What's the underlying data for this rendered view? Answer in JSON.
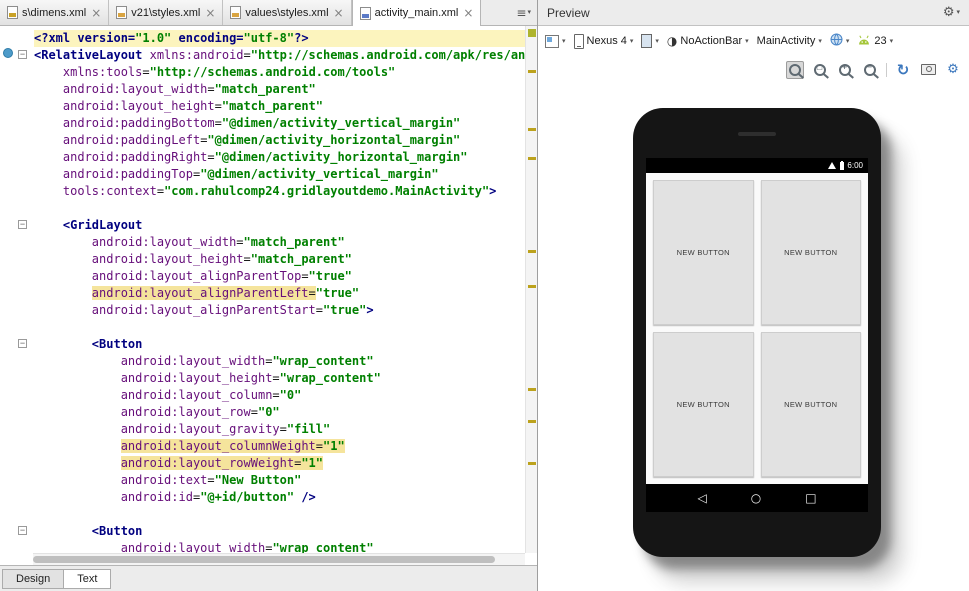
{
  "colors": {
    "tag": "#000080",
    "attribute": "#660E7A",
    "value": "#008000",
    "caret_line": "#FCF4BE",
    "search_highlight": "#F5E49C",
    "accent_blue": "#3B77BD",
    "android_green": "#A4C639"
  },
  "icons": {
    "gear": "⚙",
    "caret": "▾",
    "tab_list": "≡",
    "theme_circle": "◑",
    "refresh": "↻",
    "zoom_in": "+",
    "zoom_out": "−",
    "zoom_fit": "□",
    "fold": "−",
    "close": "×"
  },
  "editor_tabs": {
    "tabs": [
      {
        "label": "s\\dimens.xml",
        "close": "×",
        "icon_color": "#C9A227",
        "active": false
      },
      {
        "label": "v21\\styles.xml",
        "close": "×",
        "icon_color": "#D9A441",
        "active": false
      },
      {
        "label": "values\\styles.xml",
        "close": "×",
        "icon_color": "#D9A441",
        "active": false
      },
      {
        "label": "activity_main.xml",
        "close": "×",
        "icon_color": "#5B7AC7",
        "active": true
      }
    ]
  },
  "editor": {
    "lines": [
      {
        "caret": true,
        "segs": [
          {
            "t": "pi",
            "s": "<?xml version="
          },
          {
            "t": "val",
            "s": "\"1.0\""
          },
          {
            "t": "pi",
            "s": " encoding="
          },
          {
            "t": "val",
            "s": "\"utf-8\""
          },
          {
            "t": "pi",
            "s": "?>"
          }
        ]
      },
      {
        "fold": true,
        "segs": [
          {
            "t": "tag",
            "s": "<RelativeLayout "
          },
          {
            "t": "attr",
            "s": "xmlns:android"
          },
          {
            "t": "eq",
            "s": "="
          },
          {
            "t": "val",
            "s": "\"http://schemas.android.com/apk/res/android\""
          }
        ]
      },
      {
        "segs": [
          {
            "t": "txt",
            "s": "    "
          },
          {
            "t": "attr",
            "s": "xmlns:tools"
          },
          {
            "t": "eq",
            "s": "="
          },
          {
            "t": "val",
            "s": "\"http://schemas.android.com/tools\""
          }
        ]
      },
      {
        "segs": [
          {
            "t": "txt",
            "s": "    "
          },
          {
            "t": "attr",
            "s": "android:layout_width"
          },
          {
            "t": "eq",
            "s": "="
          },
          {
            "t": "val",
            "s": "\"match_parent\""
          }
        ]
      },
      {
        "segs": [
          {
            "t": "txt",
            "s": "    "
          },
          {
            "t": "attr",
            "s": "android:layout_height"
          },
          {
            "t": "eq",
            "s": "="
          },
          {
            "t": "val",
            "s": "\"match_parent\""
          }
        ]
      },
      {
        "segs": [
          {
            "t": "txt",
            "s": "    "
          },
          {
            "t": "attr",
            "s": "android:paddingBottom"
          },
          {
            "t": "eq",
            "s": "="
          },
          {
            "t": "val",
            "s": "\"@dimen/activity_vertical_margin\""
          }
        ]
      },
      {
        "segs": [
          {
            "t": "txt",
            "s": "    "
          },
          {
            "t": "attr",
            "s": "android:paddingLeft"
          },
          {
            "t": "eq",
            "s": "="
          },
          {
            "t": "val",
            "s": "\"@dimen/activity_horizontal_margin\""
          }
        ]
      },
      {
        "segs": [
          {
            "t": "txt",
            "s": "    "
          },
          {
            "t": "attr",
            "s": "android:paddingRight"
          },
          {
            "t": "eq",
            "s": "="
          },
          {
            "t": "val",
            "s": "\"@dimen/activity_horizontal_margin\""
          }
        ]
      },
      {
        "segs": [
          {
            "t": "txt",
            "s": "    "
          },
          {
            "t": "attr",
            "s": "android:paddingTop"
          },
          {
            "t": "eq",
            "s": "="
          },
          {
            "t": "val",
            "s": "\"@dimen/activity_vertical_margin\""
          }
        ]
      },
      {
        "segs": [
          {
            "t": "txt",
            "s": "    "
          },
          {
            "t": "attr",
            "s": "tools:context"
          },
          {
            "t": "eq",
            "s": "="
          },
          {
            "t": "val",
            "s": "\"com.rahulcomp24.gridlayoutdemo.MainActivity\""
          },
          {
            "t": "tag",
            "s": ">"
          }
        ]
      },
      {
        "segs": []
      },
      {
        "fold": true,
        "segs": [
          {
            "t": "txt",
            "s": "    "
          },
          {
            "t": "tag",
            "s": "<GridLayout"
          }
        ]
      },
      {
        "segs": [
          {
            "t": "txt",
            "s": "        "
          },
          {
            "t": "attr",
            "s": "android:layout_width"
          },
          {
            "t": "eq",
            "s": "="
          },
          {
            "t": "val",
            "s": "\"match_parent\""
          }
        ]
      },
      {
        "segs": [
          {
            "t": "txt",
            "s": "        "
          },
          {
            "t": "attr",
            "s": "android:layout_height"
          },
          {
            "t": "eq",
            "s": "="
          },
          {
            "t": "val",
            "s": "\"match_parent\""
          }
        ]
      },
      {
        "segs": [
          {
            "t": "txt",
            "s": "        "
          },
          {
            "t": "attr",
            "s": "android:layout_alignParentTop"
          },
          {
            "t": "eq",
            "s": "="
          },
          {
            "t": "val",
            "s": "\"true\""
          }
        ]
      },
      {
        "segs": [
          {
            "t": "txt",
            "s": "        "
          },
          {
            "t": "attr",
            "s": "android:layout_alignParentLeft",
            "h": true
          },
          {
            "t": "eq",
            "s": "=",
            "h": true
          },
          {
            "t": "val",
            "s": "\"true\""
          }
        ]
      },
      {
        "segs": [
          {
            "t": "txt",
            "s": "        "
          },
          {
            "t": "attr",
            "s": "android:layout_alignParentStart"
          },
          {
            "t": "eq",
            "s": "="
          },
          {
            "t": "val",
            "s": "\"true\""
          },
          {
            "t": "tag",
            "s": ">"
          }
        ]
      },
      {
        "segs": []
      },
      {
        "fold": true,
        "segs": [
          {
            "t": "txt",
            "s": "        "
          },
          {
            "t": "tag",
            "s": "<Button"
          }
        ]
      },
      {
        "segs": [
          {
            "t": "txt",
            "s": "            "
          },
          {
            "t": "attr",
            "s": "android:layout_width"
          },
          {
            "t": "eq",
            "s": "="
          },
          {
            "t": "val",
            "s": "\"wrap_content\""
          }
        ]
      },
      {
        "segs": [
          {
            "t": "txt",
            "s": "            "
          },
          {
            "t": "attr",
            "s": "android:layout_height"
          },
          {
            "t": "eq",
            "s": "="
          },
          {
            "t": "val",
            "s": "\"wrap_content\""
          }
        ]
      },
      {
        "segs": [
          {
            "t": "txt",
            "s": "            "
          },
          {
            "t": "attr",
            "s": "android:layout_column"
          },
          {
            "t": "eq",
            "s": "="
          },
          {
            "t": "val",
            "s": "\"0\""
          }
        ]
      },
      {
        "segs": [
          {
            "t": "txt",
            "s": "            "
          },
          {
            "t": "attr",
            "s": "android:layout_row"
          },
          {
            "t": "eq",
            "s": "="
          },
          {
            "t": "val",
            "s": "\"0\""
          }
        ]
      },
      {
        "segs": [
          {
            "t": "txt",
            "s": "            "
          },
          {
            "t": "attr",
            "s": "android:layout_gravity"
          },
          {
            "t": "eq",
            "s": "="
          },
          {
            "t": "val",
            "s": "\"fill\""
          }
        ]
      },
      {
        "segs": [
          {
            "t": "txt",
            "s": "            "
          },
          {
            "t": "attr",
            "s": "android:layout_columnWeight",
            "h": true
          },
          {
            "t": "eq",
            "s": "=",
            "h": true
          },
          {
            "t": "val",
            "s": "\"1\"",
            "h": true
          }
        ]
      },
      {
        "segs": [
          {
            "t": "txt",
            "s": "            "
          },
          {
            "t": "attr",
            "s": "android:layout_rowWeight",
            "h": true
          },
          {
            "t": "eq",
            "s": "=",
            "h": true
          },
          {
            "t": "val",
            "s": "\"1\"",
            "h": true
          }
        ]
      },
      {
        "segs": [
          {
            "t": "txt",
            "s": "            "
          },
          {
            "t": "attr",
            "s": "android:text"
          },
          {
            "t": "eq",
            "s": "="
          },
          {
            "t": "val",
            "s": "\"New Button\""
          }
        ]
      },
      {
        "segs": [
          {
            "t": "txt",
            "s": "            "
          },
          {
            "t": "attr",
            "s": "android:id"
          },
          {
            "t": "eq",
            "s": "="
          },
          {
            "t": "val",
            "s": "\"@+id/button\""
          },
          {
            "t": "tag",
            "s": " />"
          }
        ]
      },
      {
        "segs": []
      },
      {
        "fold": true,
        "segs": [
          {
            "t": "txt",
            "s": "        "
          },
          {
            "t": "tag",
            "s": "<Button"
          }
        ]
      },
      {
        "segs": [
          {
            "t": "txt",
            "s": "            "
          },
          {
            "t": "attr",
            "s": "android:layout_width"
          },
          {
            "t": "eq",
            "s": "="
          },
          {
            "t": "val",
            "s": "\"wrap_content\""
          }
        ]
      }
    ]
  },
  "bottom_tabs": {
    "design_label": "Design",
    "text_label": "Text"
  },
  "preview": {
    "header_title": "Preview",
    "toolbar": {
      "device_label": "Nexus 4",
      "theme_label": "NoActionBar",
      "activity_label": "MainActivity",
      "api_label": "23"
    },
    "device": {
      "status_time": "6:00",
      "buttons": [
        "NEW BUTTON",
        "NEW BUTTON",
        "NEW BUTTON",
        "NEW BUTTON"
      ],
      "nav": {
        "back": "◁",
        "home": "○",
        "recents": "□"
      }
    }
  }
}
